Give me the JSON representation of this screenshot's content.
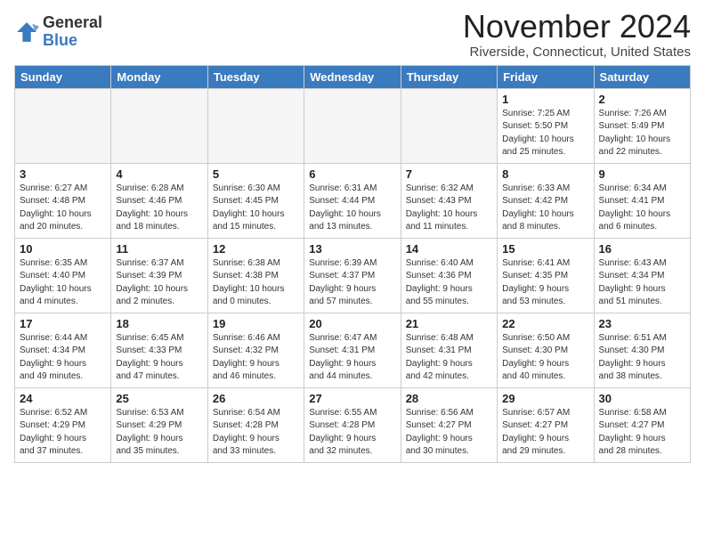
{
  "header": {
    "logo_general": "General",
    "logo_blue": "Blue",
    "month_title": "November 2024",
    "location": "Riverside, Connecticut, United States"
  },
  "weekdays": [
    "Sunday",
    "Monday",
    "Tuesday",
    "Wednesday",
    "Thursday",
    "Friday",
    "Saturday"
  ],
  "weeks": [
    [
      {
        "day": "",
        "info": ""
      },
      {
        "day": "",
        "info": ""
      },
      {
        "day": "",
        "info": ""
      },
      {
        "day": "",
        "info": ""
      },
      {
        "day": "",
        "info": ""
      },
      {
        "day": "1",
        "info": "Sunrise: 7:25 AM\nSunset: 5:50 PM\nDaylight: 10 hours\nand 25 minutes."
      },
      {
        "day": "2",
        "info": "Sunrise: 7:26 AM\nSunset: 5:49 PM\nDaylight: 10 hours\nand 22 minutes."
      }
    ],
    [
      {
        "day": "3",
        "info": "Sunrise: 6:27 AM\nSunset: 4:48 PM\nDaylight: 10 hours\nand 20 minutes."
      },
      {
        "day": "4",
        "info": "Sunrise: 6:28 AM\nSunset: 4:46 PM\nDaylight: 10 hours\nand 18 minutes."
      },
      {
        "day": "5",
        "info": "Sunrise: 6:30 AM\nSunset: 4:45 PM\nDaylight: 10 hours\nand 15 minutes."
      },
      {
        "day": "6",
        "info": "Sunrise: 6:31 AM\nSunset: 4:44 PM\nDaylight: 10 hours\nand 13 minutes."
      },
      {
        "day": "7",
        "info": "Sunrise: 6:32 AM\nSunset: 4:43 PM\nDaylight: 10 hours\nand 11 minutes."
      },
      {
        "day": "8",
        "info": "Sunrise: 6:33 AM\nSunset: 4:42 PM\nDaylight: 10 hours\nand 8 minutes."
      },
      {
        "day": "9",
        "info": "Sunrise: 6:34 AM\nSunset: 4:41 PM\nDaylight: 10 hours\nand 6 minutes."
      }
    ],
    [
      {
        "day": "10",
        "info": "Sunrise: 6:35 AM\nSunset: 4:40 PM\nDaylight: 10 hours\nand 4 minutes."
      },
      {
        "day": "11",
        "info": "Sunrise: 6:37 AM\nSunset: 4:39 PM\nDaylight: 10 hours\nand 2 minutes."
      },
      {
        "day": "12",
        "info": "Sunrise: 6:38 AM\nSunset: 4:38 PM\nDaylight: 10 hours\nand 0 minutes."
      },
      {
        "day": "13",
        "info": "Sunrise: 6:39 AM\nSunset: 4:37 PM\nDaylight: 9 hours\nand 57 minutes."
      },
      {
        "day": "14",
        "info": "Sunrise: 6:40 AM\nSunset: 4:36 PM\nDaylight: 9 hours\nand 55 minutes."
      },
      {
        "day": "15",
        "info": "Sunrise: 6:41 AM\nSunset: 4:35 PM\nDaylight: 9 hours\nand 53 minutes."
      },
      {
        "day": "16",
        "info": "Sunrise: 6:43 AM\nSunset: 4:34 PM\nDaylight: 9 hours\nand 51 minutes."
      }
    ],
    [
      {
        "day": "17",
        "info": "Sunrise: 6:44 AM\nSunset: 4:34 PM\nDaylight: 9 hours\nand 49 minutes."
      },
      {
        "day": "18",
        "info": "Sunrise: 6:45 AM\nSunset: 4:33 PM\nDaylight: 9 hours\nand 47 minutes."
      },
      {
        "day": "19",
        "info": "Sunrise: 6:46 AM\nSunset: 4:32 PM\nDaylight: 9 hours\nand 46 minutes."
      },
      {
        "day": "20",
        "info": "Sunrise: 6:47 AM\nSunset: 4:31 PM\nDaylight: 9 hours\nand 44 minutes."
      },
      {
        "day": "21",
        "info": "Sunrise: 6:48 AM\nSunset: 4:31 PM\nDaylight: 9 hours\nand 42 minutes."
      },
      {
        "day": "22",
        "info": "Sunrise: 6:50 AM\nSunset: 4:30 PM\nDaylight: 9 hours\nand 40 minutes."
      },
      {
        "day": "23",
        "info": "Sunrise: 6:51 AM\nSunset: 4:30 PM\nDaylight: 9 hours\nand 38 minutes."
      }
    ],
    [
      {
        "day": "24",
        "info": "Sunrise: 6:52 AM\nSunset: 4:29 PM\nDaylight: 9 hours\nand 37 minutes."
      },
      {
        "day": "25",
        "info": "Sunrise: 6:53 AM\nSunset: 4:29 PM\nDaylight: 9 hours\nand 35 minutes."
      },
      {
        "day": "26",
        "info": "Sunrise: 6:54 AM\nSunset: 4:28 PM\nDaylight: 9 hours\nand 33 minutes."
      },
      {
        "day": "27",
        "info": "Sunrise: 6:55 AM\nSunset: 4:28 PM\nDaylight: 9 hours\nand 32 minutes."
      },
      {
        "day": "28",
        "info": "Sunrise: 6:56 AM\nSunset: 4:27 PM\nDaylight: 9 hours\nand 30 minutes."
      },
      {
        "day": "29",
        "info": "Sunrise: 6:57 AM\nSunset: 4:27 PM\nDaylight: 9 hours\nand 29 minutes."
      },
      {
        "day": "30",
        "info": "Sunrise: 6:58 AM\nSunset: 4:27 PM\nDaylight: 9 hours\nand 28 minutes."
      }
    ]
  ]
}
